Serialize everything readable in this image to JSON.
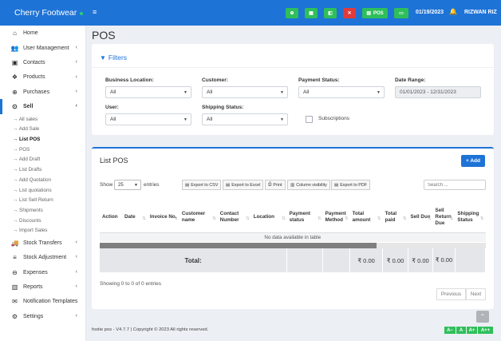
{
  "brand": {
    "name": "Cherry Footwear"
  },
  "sidebar": {
    "items": [
      {
        "label": "Home",
        "icon": "home-icon"
      },
      {
        "label": "User Management",
        "icon": "users-icon"
      },
      {
        "label": "Contacts",
        "icon": "address-book-icon"
      },
      {
        "label": "Products",
        "icon": "cubes-icon"
      },
      {
        "label": "Purchases",
        "icon": "plus-circle-icon"
      },
      {
        "label": "Sell",
        "icon": "sell-icon"
      },
      {
        "label": "Stock Transfers",
        "icon": "truck-icon"
      },
      {
        "label": "Stock Adjustment",
        "icon": "database-icon"
      },
      {
        "label": "Expenses",
        "icon": "minus-circle-icon"
      },
      {
        "label": "Reports",
        "icon": "chart-icon"
      },
      {
        "label": "Notification Templates",
        "icon": "envelope-icon"
      },
      {
        "label": "Settings",
        "icon": "gear-icon"
      }
    ],
    "sell_sub": [
      "→ All sales",
      "→ Add Sale",
      "→ List POS",
      "→ POS",
      "→ Add Draft",
      "→ List Drafts",
      "→ Add Quotation",
      "→ List quotations",
      "→ List Sell Return",
      "→ Shipments",
      "→ Discounts",
      "→ Import Sales"
    ]
  },
  "topbar": {
    "pos_label": "POS",
    "date": "01/19/2023",
    "user": "RIZWAN RIZ"
  },
  "page": {
    "title": "POS"
  },
  "filters": {
    "heading": "Filters",
    "business_location": {
      "label": "Business Location:",
      "value": "All"
    },
    "customer": {
      "label": "Customer:",
      "value": "All"
    },
    "payment_status": {
      "label": "Payment Status:",
      "value": "All"
    },
    "date_range": {
      "label": "Date Range:",
      "value": "01/01/2023 - 12/31/2023"
    },
    "user": {
      "label": "User:",
      "value": "All"
    },
    "shipping_status": {
      "label": "Shipping Status:",
      "value": "All"
    },
    "subscriptions": "Subscriptions"
  },
  "list": {
    "title": "List POS",
    "add_label": "+ Add",
    "show": "Show",
    "entries_value": "25",
    "entries": "entries",
    "export_csv": "Export to CSV",
    "export_excel": "Export to Excel",
    "print": "Print",
    "column_visibility": "Column visibility",
    "export_pdf": "Export to PDF",
    "search_placeholder": "Search ...",
    "columns": [
      "Action",
      "Date",
      "Invoice No.",
      "Customer name",
      "Contact Number",
      "Location",
      "Payment status",
      "Payment Method",
      "Total amount",
      "Total paid",
      "Sell Due",
      "Sell Return Due",
      "Shipping Status"
    ],
    "no_data": "No data available in table",
    "total_label": "Total:",
    "totals": {
      "total_amount": "₹ 0.00",
      "total_paid": "₹ 0.00",
      "sell_due": "₹ 0.00",
      "sell_return_due": "₹ 0.00"
    },
    "info": "Showing 0 to 0 of 0 entries",
    "previous": "Previous",
    "next": "Next"
  },
  "footer": {
    "text": "footie pos - V4.7.7 | Copyright © 2023 All rights reserved."
  },
  "font_size_buttons": [
    "A−",
    "A",
    "A+",
    "A++"
  ],
  "colors": {
    "primary": "#1e73d6",
    "success": "#2fbf5a",
    "danger": "#e23a3a"
  }
}
